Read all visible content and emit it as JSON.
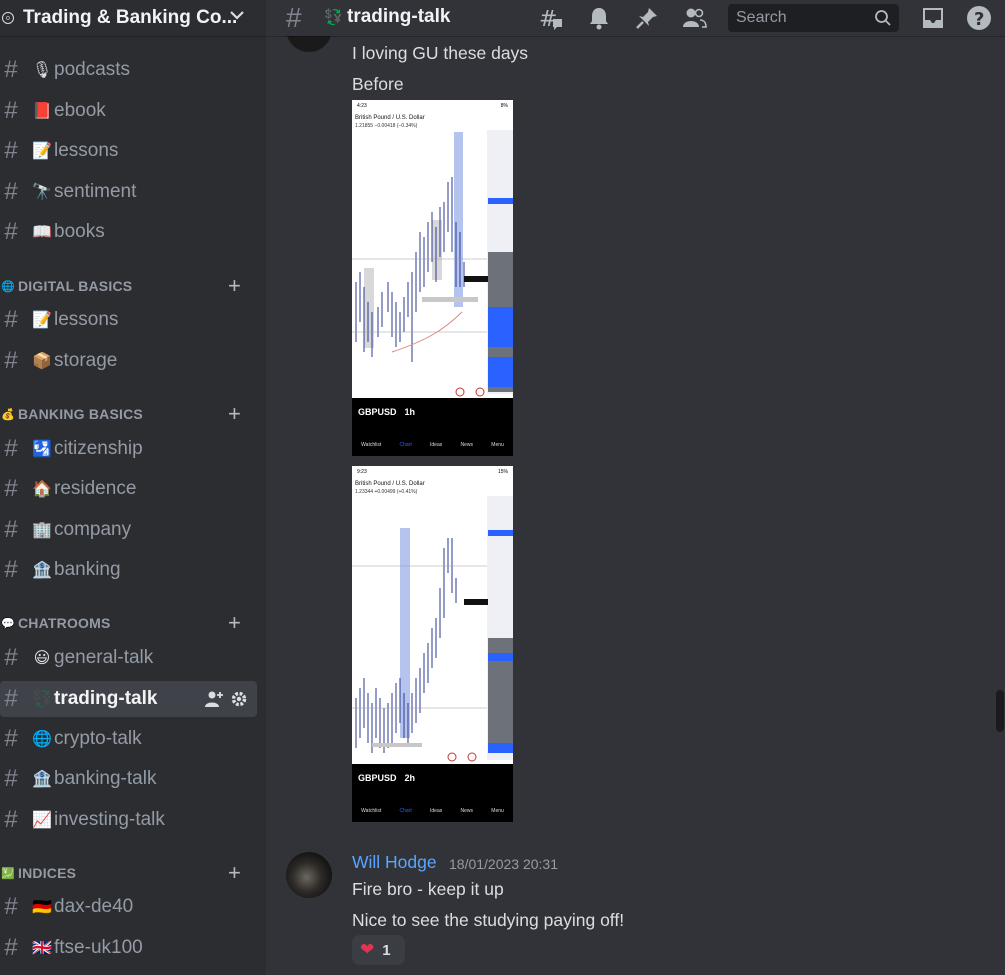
{
  "server": {
    "name": "Trading & Banking Co...",
    "icon": "o"
  },
  "sidebar": {
    "channels_top": [
      {
        "emoji": "🎙",
        "label": "podcasts"
      },
      {
        "emoji": "📕",
        "label": "ebook"
      },
      {
        "emoji": "📝",
        "label": "lessons"
      },
      {
        "emoji": "🔭",
        "label": "sentiment"
      },
      {
        "emoji": "📖",
        "label": "books"
      }
    ],
    "categories": [
      {
        "icon": "🌐",
        "label": "DIGITAL BASICS"
      },
      {
        "icon": "💰",
        "label": "BANKING BASICS"
      },
      {
        "icon": "💬",
        "label": "CHATROOMS"
      },
      {
        "icon": "💹",
        "label": "INDICES"
      }
    ],
    "digital": [
      {
        "emoji": "📝",
        "label": "lessons"
      },
      {
        "emoji": "📦",
        "label": "storage"
      }
    ],
    "banking": [
      {
        "emoji": "🛂",
        "label": "citizenship"
      },
      {
        "emoji": "🏠",
        "label": "residence"
      },
      {
        "emoji": "🏢",
        "label": "company"
      },
      {
        "emoji": "🏦",
        "label": "banking"
      }
    ],
    "chatrooms": [
      {
        "emoji": "😃",
        "label": "general-talk"
      },
      {
        "emoji": "💱",
        "label": "trading-talk"
      },
      {
        "emoji": "🌐",
        "label": "crypto-talk"
      },
      {
        "emoji": "🏦",
        "label": "banking-talk"
      },
      {
        "emoji": "📈",
        "label": "investing-talk"
      }
    ],
    "indices": [
      {
        "emoji": "🇩🇪",
        "label": "dax-de40"
      },
      {
        "emoji": "🇬🇧",
        "label": "ftse-uk100"
      }
    ]
  },
  "topbar": {
    "channel": "trading-talk",
    "emoji": "💱",
    "search_placeholder": "Search"
  },
  "messages": {
    "first": {
      "line1": "I loving GU these days",
      "line2": "Before"
    },
    "screens": [
      {
        "time": "4:23",
        "battery": "8%",
        "pair": "British Pound / U.S. Dollar",
        "price": "1.21855 −0.00418 (−0.34%)",
        "symbol": "GBPUSD",
        "tf": "1h"
      },
      {
        "time": "9:23",
        "battery": "15%",
        "pair": "British Pound / U.S. Dollar",
        "price": "1.23344 +0.00499 (+0.41%)",
        "symbol": "GBPUSD",
        "tf": "2h"
      }
    ],
    "phone_nav": [
      "Watchlist",
      "Chart",
      "Ideas",
      "News",
      "Menu"
    ],
    "reply": {
      "author": "Will Hodge",
      "timestamp": "18/01/2023 20:31",
      "line1": "Fire bro - keep it up",
      "line2": "Nice to see the studying paying off!",
      "reaction_count": "1"
    }
  },
  "colors": {
    "accent_link": "#58a6ff",
    "bg": "#313338",
    "sidebar": "#2b2d31",
    "heart": "#e0364d"
  }
}
